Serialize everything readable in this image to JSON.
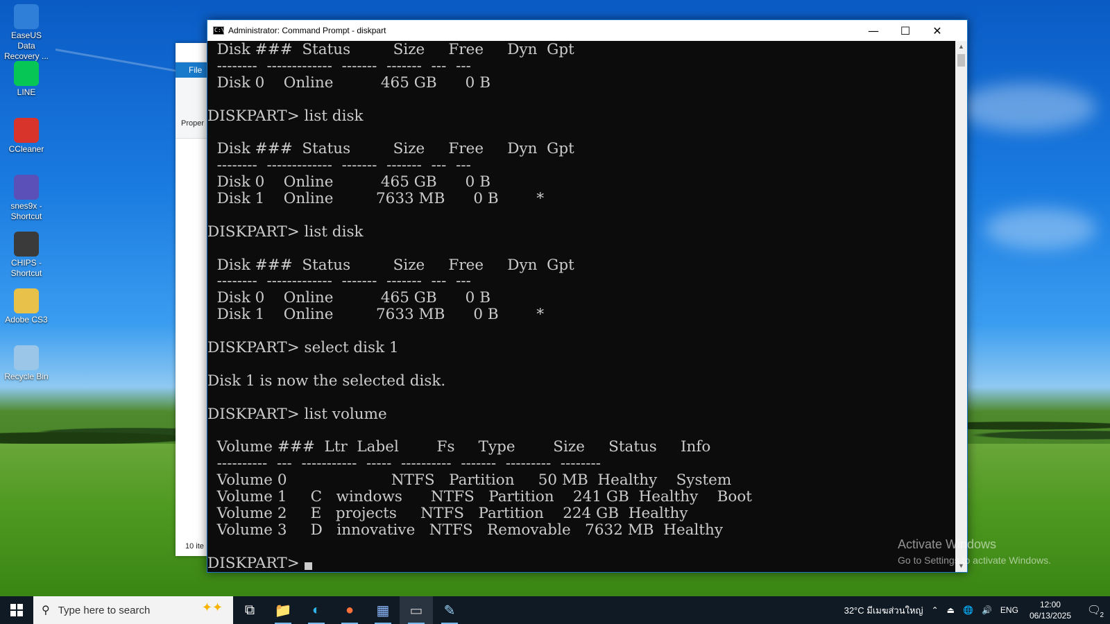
{
  "desktop": {
    "icons": [
      {
        "label": "EaseUS Data Recovery ...",
        "icon": "easeus-icon",
        "color": "#2f7fd8"
      },
      {
        "label": "LINE",
        "icon": "line-icon",
        "color": "#06c755"
      },
      {
        "label": "CCleaner",
        "icon": "ccleaner-icon",
        "color": "#d9342b"
      },
      {
        "label": "snes9x - Shortcut",
        "icon": "snes9x-icon",
        "color": "#5b4fb8"
      },
      {
        "label": "CHIPS - Shortcut",
        "icon": "chips-icon",
        "color": "#3a3a3a"
      },
      {
        "label": "Adobe CS3",
        "icon": "folder-icon",
        "color": "#e8c14a"
      },
      {
        "label": "Recycle Bin",
        "icon": "recycle-bin-icon",
        "color": "#9cc6e8"
      }
    ]
  },
  "explorer": {
    "file_tab": "File",
    "ribbon_label": "Proper",
    "status": "10 ite"
  },
  "cmd": {
    "title": "Administrator: Command Prompt - diskpart",
    "icon_text": "C:\\",
    "minimize": "—",
    "maximize": "☐",
    "close": "✕",
    "lines": [
      "  Disk ###  Status         Size     Free     Dyn  Gpt",
      "  --------  -------------  -------  -------  ---  ---",
      "  Disk 0    Online          465 GB      0 B",
      "",
      "DISKPART> list disk",
      "",
      "  Disk ###  Status         Size     Free     Dyn  Gpt",
      "  --------  -------------  -------  -------  ---  ---",
      "  Disk 0    Online          465 GB      0 B",
      "  Disk 1    Online         7633 MB      0 B        *",
      "",
      "DISKPART> list disk",
      "",
      "  Disk ###  Status         Size     Free     Dyn  Gpt",
      "  --------  -------------  -------  -------  ---  ---",
      "  Disk 0    Online          465 GB      0 B",
      "  Disk 1    Online         7633 MB      0 B        *",
      "",
      "DISKPART> select disk 1",
      "",
      "Disk 1 is now the selected disk.",
      "",
      "DISKPART> list volume",
      "",
      "  Volume ###  Ltr  Label        Fs     Type        Size     Status     Info",
      "  ----------  ---  -----------  -----  ----------  -------  ---------  --------",
      "  Volume 0                      NTFS   Partition     50 MB  Healthy    System",
      "  Volume 1     C   windows      NTFS   Partition    241 GB  Healthy    Boot",
      "  Volume 2     E   projects     NTFS   Partition    224 GB  Healthy",
      "  Volume 3     D   innovative   NTFS   Removable   7632 MB  Healthy",
      "",
      "DISKPART> "
    ]
  },
  "watermark": {
    "line1": "Activate Windows",
    "line2": "Go to Settings to activate Windows."
  },
  "taskbar": {
    "search_placeholder": "Type here to search",
    "apps": [
      {
        "name": "task-view-icon",
        "glyph": "⧉",
        "color": "#ffffff"
      },
      {
        "name": "file-explorer-icon",
        "glyph": "📁",
        "color": "#f2c84b"
      },
      {
        "name": "edge-icon",
        "glyph": "◐",
        "color": "#2fb4e8"
      },
      {
        "name": "firefox-icon",
        "glyph": "●",
        "color": "#ff7139"
      },
      {
        "name": "calculator-icon",
        "glyph": "▦",
        "color": "#8ab4f8"
      },
      {
        "name": "command-prompt-icon",
        "glyph": "▭",
        "color": "#cccccc"
      },
      {
        "name": "paint-icon",
        "glyph": "✎",
        "color": "#9ad0f5"
      }
    ],
    "weather": "32°C  มีเมฆส่วนใหญ่",
    "language": "ENG",
    "time": "12:00",
    "date": "06/13/2025",
    "notifications": "2"
  }
}
